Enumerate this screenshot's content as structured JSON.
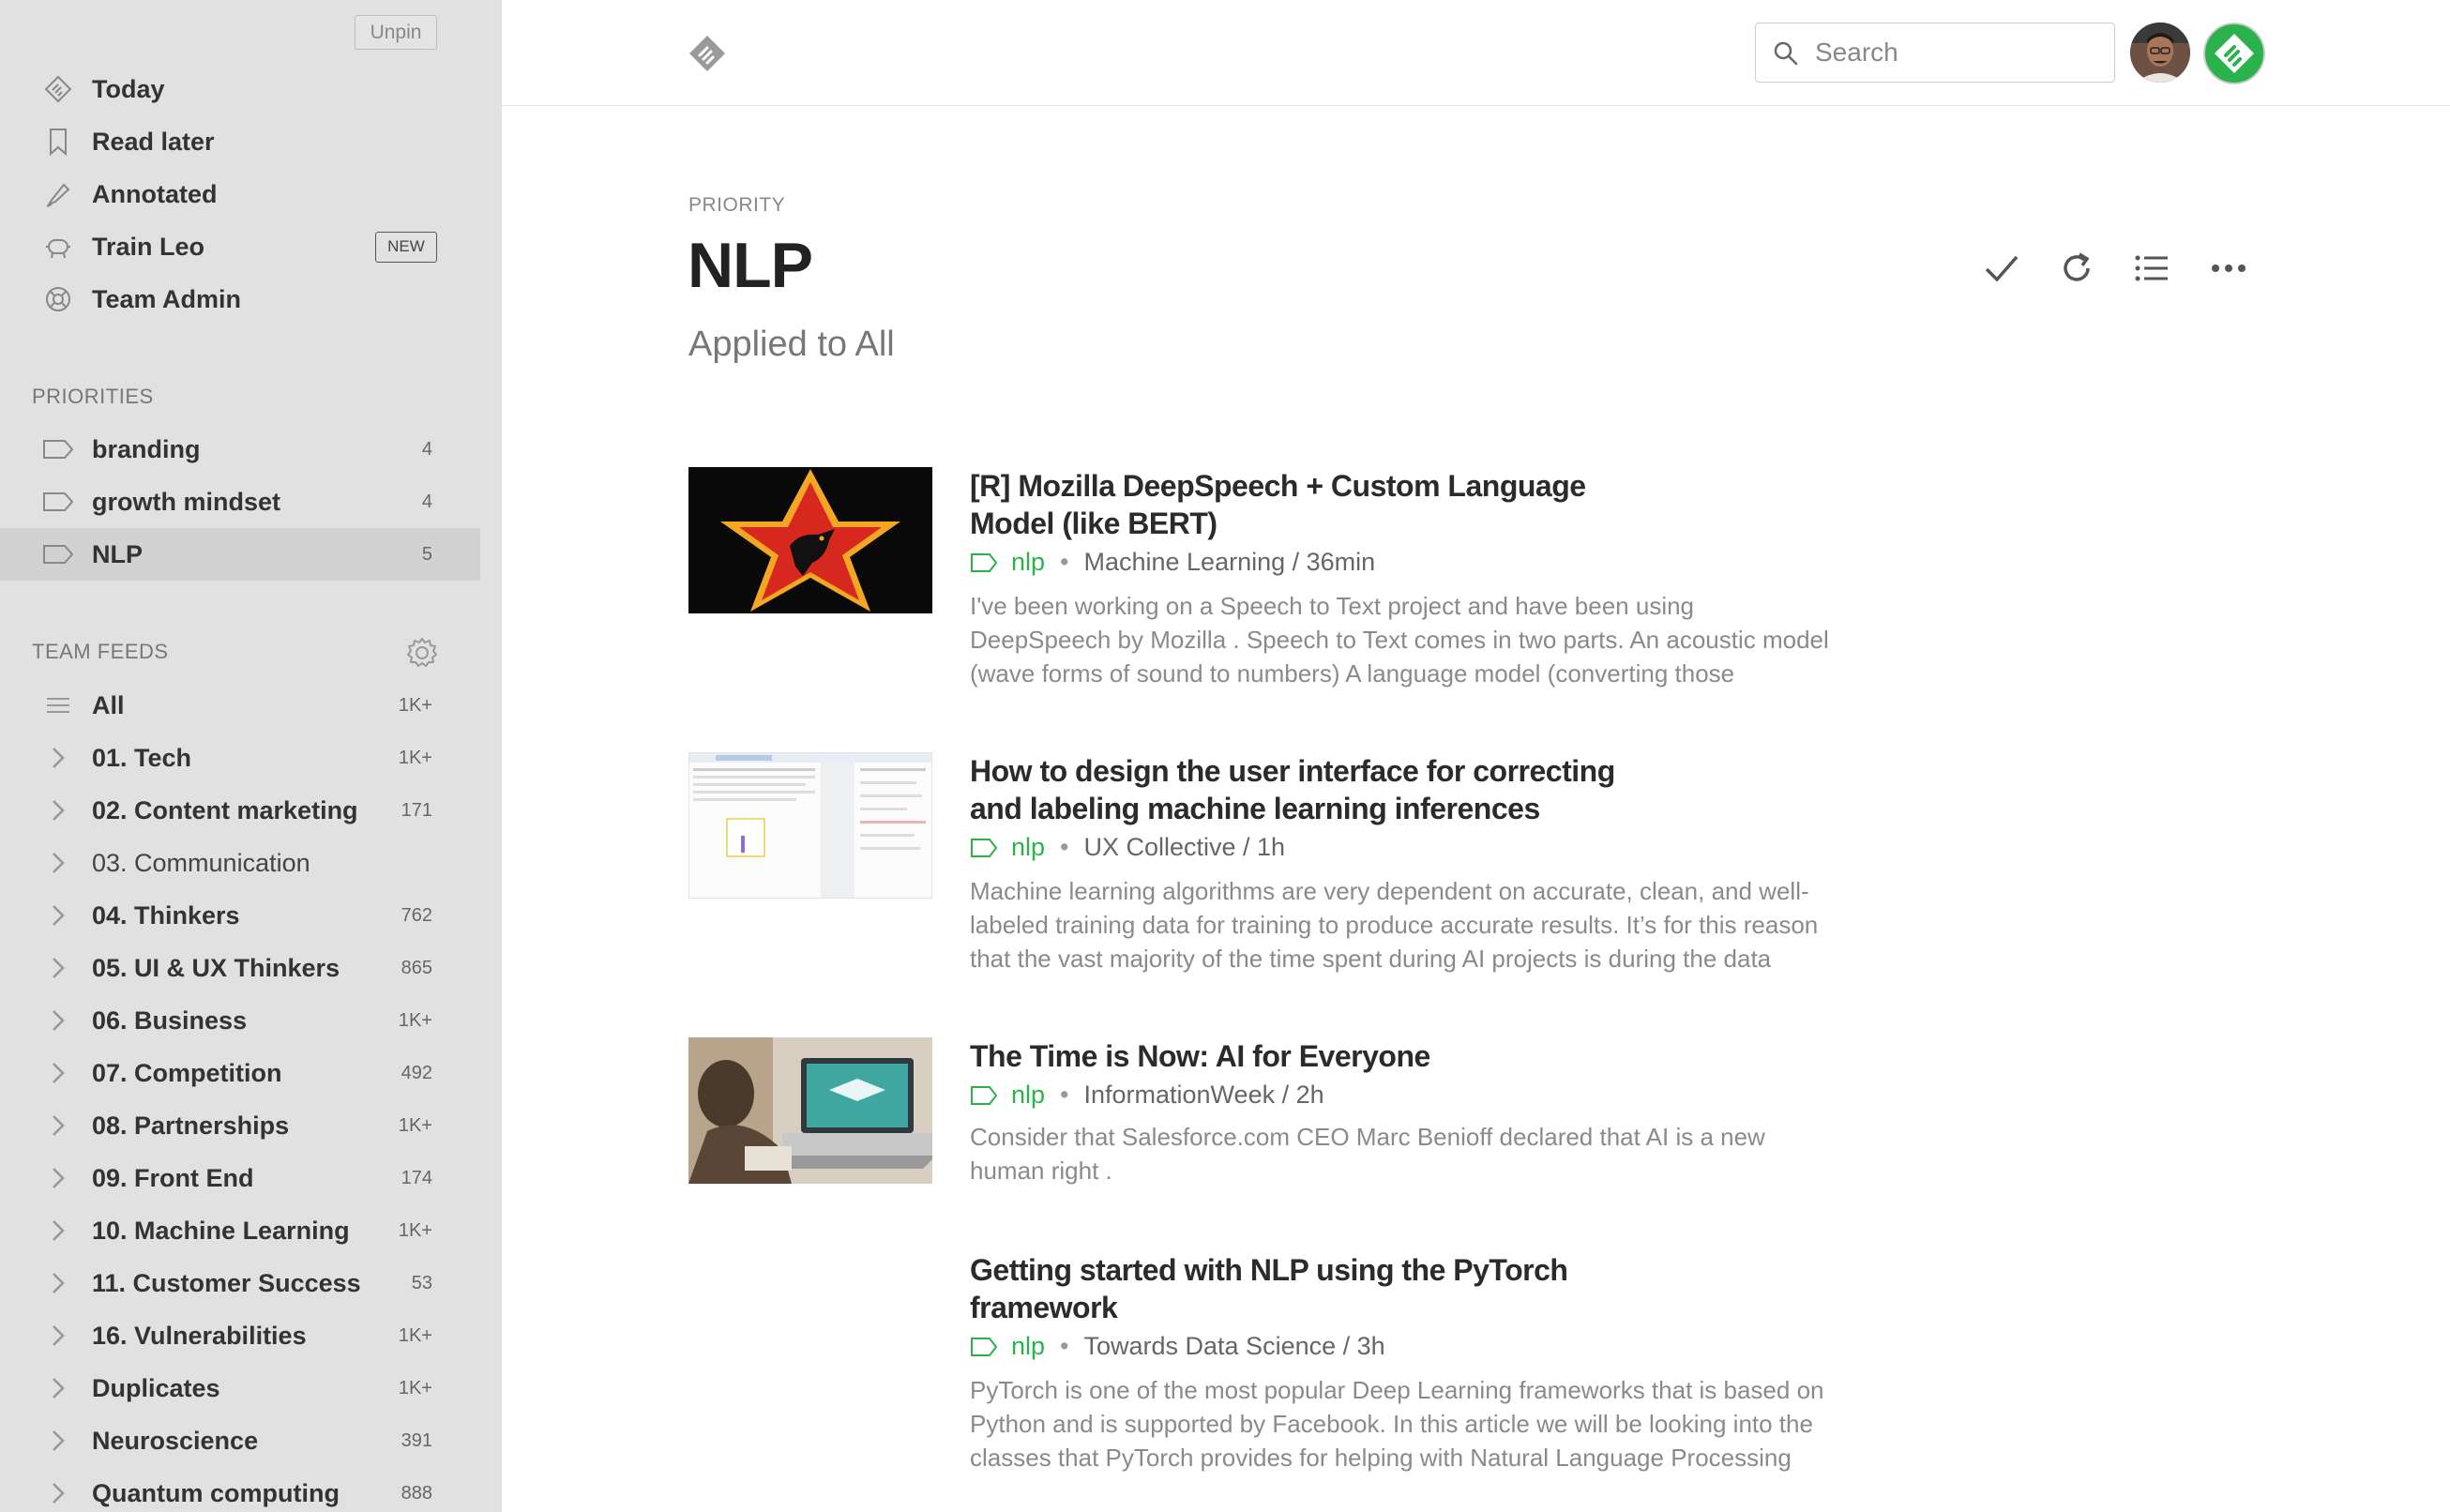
{
  "sidebar": {
    "unpin_label": "Unpin",
    "nav": [
      {
        "label": "Today",
        "icon": "feedly-today-icon"
      },
      {
        "label": "Read later",
        "icon": "bookmark-icon"
      },
      {
        "label": "Annotated",
        "icon": "highlighter-icon"
      },
      {
        "label": "Train Leo",
        "icon": "leo-robot-icon",
        "badge": "NEW"
      },
      {
        "label": "Team Admin",
        "icon": "lifebuoy-icon"
      }
    ],
    "priorities_title": "PRIORITIES",
    "priorities": [
      {
        "label": "branding",
        "count": "4"
      },
      {
        "label": "growth mindset",
        "count": "4"
      },
      {
        "label": "NLP",
        "count": "5"
      }
    ],
    "team_feeds_title": "TEAM FEEDS",
    "team_feeds": [
      {
        "label": "All",
        "count": "1K+"
      },
      {
        "label": "01. Tech",
        "count": "1K+"
      },
      {
        "label": "02. Content marketing",
        "count": "171"
      },
      {
        "label": "03. Communication",
        "count": ""
      },
      {
        "label": "04. Thinkers",
        "count": "762"
      },
      {
        "label": "05. UI & UX Thinkers",
        "count": "865"
      },
      {
        "label": "06. Business",
        "count": "1K+"
      },
      {
        "label": "07. Competition",
        "count": "492"
      },
      {
        "label": "08. Partnerships",
        "count": "1K+"
      },
      {
        "label": "09. Front End",
        "count": "174"
      },
      {
        "label": "10. Machine Learning",
        "count": "1K+"
      },
      {
        "label": "11. Customer Success",
        "count": "53"
      },
      {
        "label": "16. Vulnerabilities",
        "count": "1K+"
      },
      {
        "label": "Duplicates",
        "count": "1K+"
      },
      {
        "label": "Neuroscience",
        "count": "391"
      },
      {
        "label": "Quantum computing",
        "count": "888"
      }
    ]
  },
  "topbar": {
    "search_placeholder": "Search"
  },
  "header": {
    "kicker": "PRIORITY",
    "title": "NLP",
    "subtitle": "Applied to All"
  },
  "articles": [
    {
      "title": "[R] Mozilla DeepSpeech + Custom Language Model (like BERT)",
      "tag": "nlp",
      "source": "Machine Learning / 36min",
      "summary": "I've been working on a Speech to Text project and have been using DeepSpeech by Mozilla . Speech to Text comes in two parts. An acoustic model (wave forms of sound to numbers) A language model (converting those"
    },
    {
      "title": "How to design the user interface for correcting and labeling machine learning inferences",
      "tag": "nlp",
      "source": "UX Collective / 1h",
      "summary": "Machine learning algorithms are very dependent on accurate, clean, and well-labeled training data for training to produce accurate results. It’s for this reason that the vast majority of the time spent during AI projects is during the data"
    },
    {
      "title": "The Time is Now: AI for Everyone",
      "tag": "nlp",
      "source": "InformationWeek / 2h",
      "summary": "Consider that Salesforce.com CEO Marc Benioff declared that AI is a new human right ."
    },
    {
      "title": "Getting started with NLP using the PyTorch framework",
      "tag": "nlp",
      "source": "Towards Data Science / 3h",
      "summary": "PyTorch is one of the most popular Deep Learning frameworks that is based on Python and is supported by Facebook. In this article we will be looking into the classes that PyTorch provides for helping with Natural Language Processing"
    }
  ],
  "colors": {
    "sidebar_bg": "#e1e1e1",
    "tag_green": "#2bb24c",
    "feedly_green": "#2bb24c"
  }
}
